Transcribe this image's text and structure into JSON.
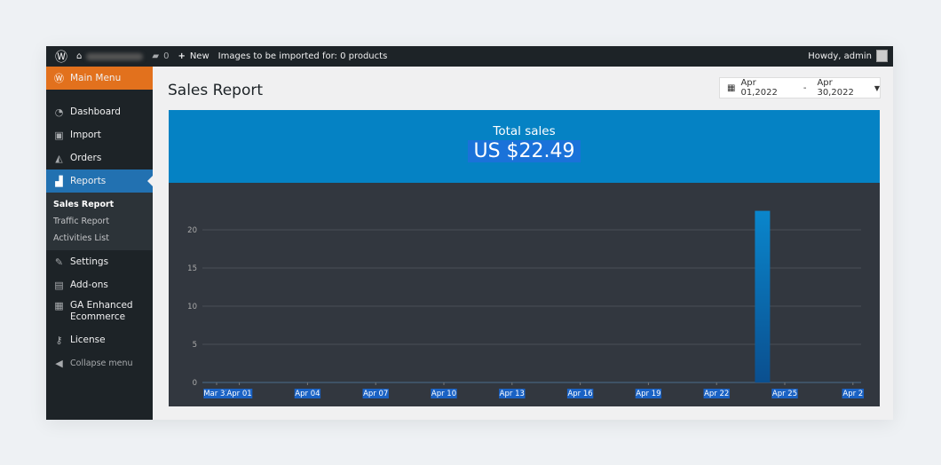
{
  "topbar": {
    "comments": "0",
    "new": "New",
    "notice": "Images to be imported for: 0 products",
    "howdy": "Howdy, admin"
  },
  "sidebar": {
    "main": "Main Menu",
    "items": [
      "Dashboard",
      "Import",
      "Orders",
      "Reports"
    ],
    "sub": [
      "Sales Report",
      "Traffic Report",
      "Activities List"
    ],
    "items2": [
      "Settings",
      "Add-ons",
      "GA Enhanced Ecommerce",
      "License",
      "Collapse menu"
    ]
  },
  "page": {
    "title": "Sales Report",
    "date_from": "Apr 01,2022",
    "date_sep": "-",
    "date_to": "Apr 30,2022"
  },
  "summary": {
    "label": "Total sales",
    "value": "US $22.49"
  },
  "colors": {
    "accent": "#0582c4",
    "bar": "#0582c4",
    "menu_active": "#2271b1",
    "main_menu": "#e2711d"
  },
  "chart_data": {
    "type": "bar",
    "x_ticks": [
      "Mar 31",
      "Apr 01",
      "Apr 04",
      "Apr 07",
      "Apr 10",
      "Apr 13",
      "Apr 16",
      "Apr 19",
      "Apr 22",
      "Apr 25",
      "Apr 2"
    ],
    "y_ticks": [
      0,
      5,
      10,
      15,
      20
    ],
    "ylim": [
      0,
      25
    ],
    "grid": true,
    "points": [
      {
        "x": "Apr 24",
        "y": 22.49
      }
    ]
  }
}
